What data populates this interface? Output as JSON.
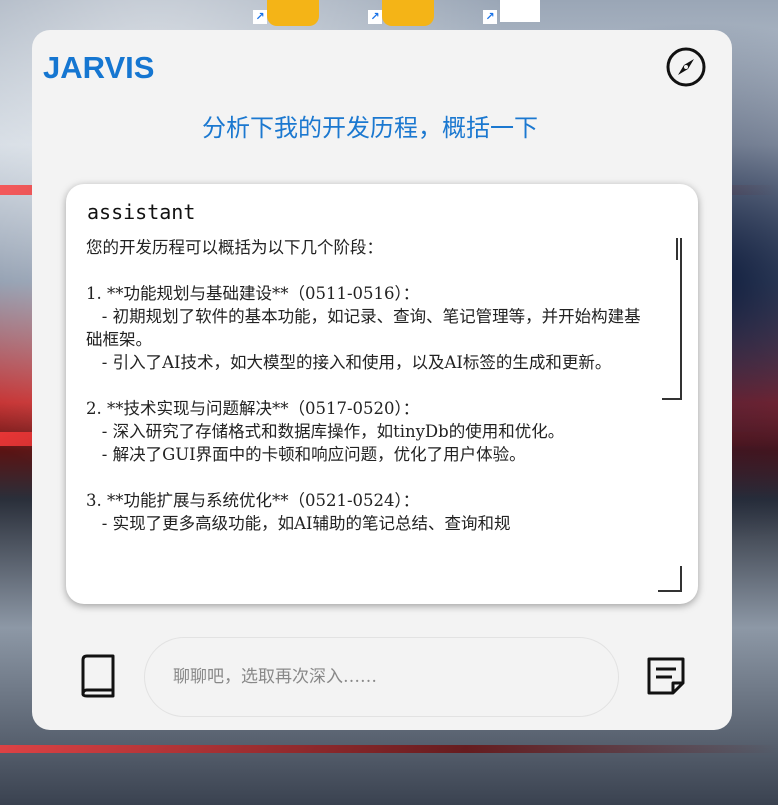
{
  "app": {
    "title": "JARVIS"
  },
  "question": "分析下我的开发历程，概括一下",
  "message": {
    "role": "assistant",
    "lines": [
      "您的开发历程可以概括为以下几个阶段：",
      "",
      "1. **功能规划与基础建设**（0511-0516）：",
      "   - 初期规划了软件的基本功能，如记录、查询、笔记管理等，并开始构建基础框架。",
      "   - 引入了AI技术，如大模型的接入和使用，以及AI标签的生成和更新。",
      "",
      "2. **技术实现与问题解决**（0517-0520）：",
      "   - 深入研究了存储格式和数据库操作，如tinyDb的使用和优化。",
      "   - 解决了GUI界面中的卡顿和响应问题，优化了用户体验。",
      "",
      "3. **功能扩展与系统优化**（0521-0524）：",
      "   - 实现了更多高级功能，如AI辅助的笔记总结、查询和规"
    ]
  },
  "input": {
    "placeholder": "聊聊吧，选取再次深入……",
    "value": ""
  },
  "icons": {
    "compass": "compass-icon",
    "book": "book-icon",
    "note": "note-icon"
  },
  "colors": {
    "accent": "#1576d1",
    "panel": "#f3f3f3"
  }
}
